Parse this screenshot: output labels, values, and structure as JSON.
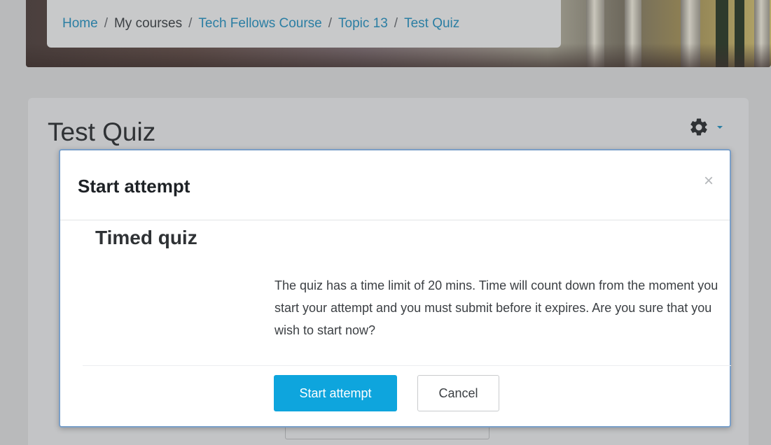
{
  "breadcrumb": {
    "items": [
      {
        "label": "Home",
        "link": true
      },
      {
        "label": "My courses",
        "link": false
      },
      {
        "label": "Tech Fellows Course",
        "link": true
      },
      {
        "label": "Topic 13",
        "link": true
      },
      {
        "label": "Test Quiz",
        "link": true
      }
    ],
    "separator": "/"
  },
  "page": {
    "title": "Test Quiz",
    "settings_icon": "gear-icon",
    "settings_caret": "caret-down-icon"
  },
  "modal": {
    "title": "Start attempt",
    "close_label": "×",
    "section_title": "Timed quiz",
    "message": "The quiz has a time limit of 20 mins. Time will count down from the moment you start your attempt and you must submit before it expires. Are you sure that you wish to start now?",
    "primary_button": "Start attempt",
    "secondary_button": "Cancel"
  },
  "colors": {
    "link": "#2b7ea3",
    "primary": "#0ea5dd",
    "overlay": "#b9babb",
    "modal_border": "#7a9fc8"
  }
}
